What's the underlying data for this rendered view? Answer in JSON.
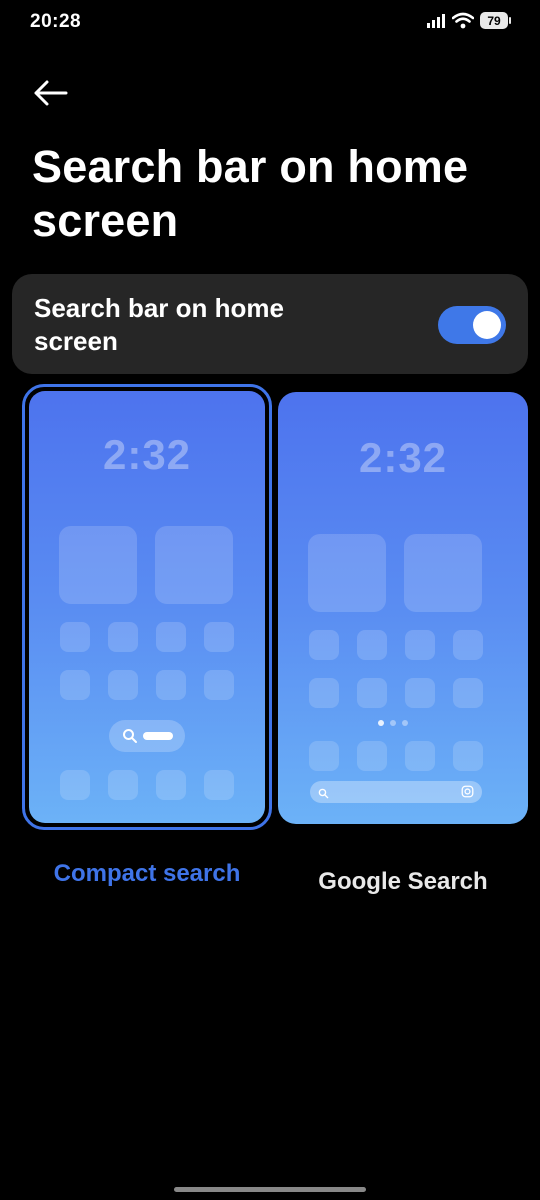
{
  "status_bar": {
    "time": "20:28",
    "battery": "79",
    "icons": [
      "signal-icon",
      "wifi-icon",
      "battery-icon"
    ]
  },
  "header": {
    "back_icon": "arrow-left-icon",
    "title": "Search bar on home screen"
  },
  "toggle": {
    "label": "Search bar on home screen",
    "enabled": true,
    "accent": "#3f78e8"
  },
  "options": [
    {
      "label": "Compact search",
      "clock": "2:32",
      "selected": true
    },
    {
      "label": "Google Search",
      "clock": "2:32",
      "selected": false
    }
  ],
  "colors": {
    "background": "#000000",
    "card": "#262626",
    "selected_accent": "#3f74e8",
    "preview_gradient_top": "#4d73ee",
    "preview_gradient_bottom": "#6cb2f7"
  }
}
